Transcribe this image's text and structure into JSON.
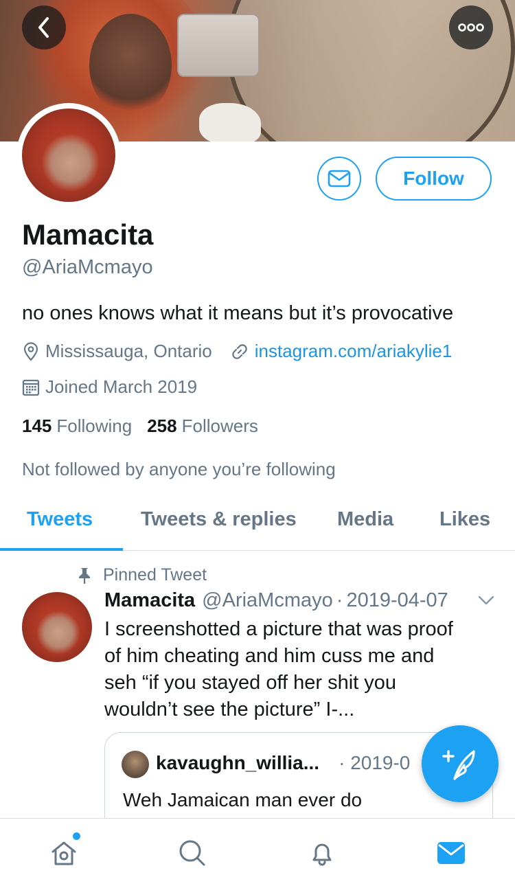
{
  "header": {
    "back_icon": "chevron-left-icon",
    "more_icon": "more-dots-icon"
  },
  "profile": {
    "display_name": "Mamacita",
    "handle": "@AriaMcmayo",
    "bio": "no ones knows what it means but it’s provocative",
    "location": "Mississauga, Ontario",
    "website": "instagram.com/ariakylie1",
    "joined": "Joined March 2019",
    "following_count": "145",
    "following_label": "Following",
    "followers_count": "258",
    "followers_label": "Followers",
    "not_followed_text": "Not followed by anyone you’re following",
    "follow_button": "Follow"
  },
  "tabs": [
    {
      "label": "Tweets",
      "active": true
    },
    {
      "label": "Tweets & replies",
      "active": false
    },
    {
      "label": "Media",
      "active": false
    },
    {
      "label": "Likes",
      "active": false
    }
  ],
  "pinned_tweet": {
    "pinned_label": "Pinned Tweet",
    "author_name": "Mamacita",
    "author_handle": "@AriaMcmayo",
    "separator": "·",
    "date": "2019-04-07",
    "text_lines": [
      "I screenshotted a picture that was proof",
      "of him cheating and him cuss me and",
      "seh “if you stayed off her shit you",
      "wouldn’t see the picture” I-..."
    ],
    "quote": {
      "author_name": "kavaughn_willia...",
      "date": "· 2019-0",
      "text": "Weh Jamaican man ever do"
    }
  },
  "bottom_nav": [
    {
      "icon": "home-icon",
      "has_notification_dot": true
    },
    {
      "icon": "search-icon"
    },
    {
      "icon": "bell-icon"
    },
    {
      "icon": "mail-icon",
      "active": true
    }
  ],
  "colors": {
    "accent": "#1da1f2",
    "secondary_text": "#657786",
    "primary_text": "#14171a"
  }
}
